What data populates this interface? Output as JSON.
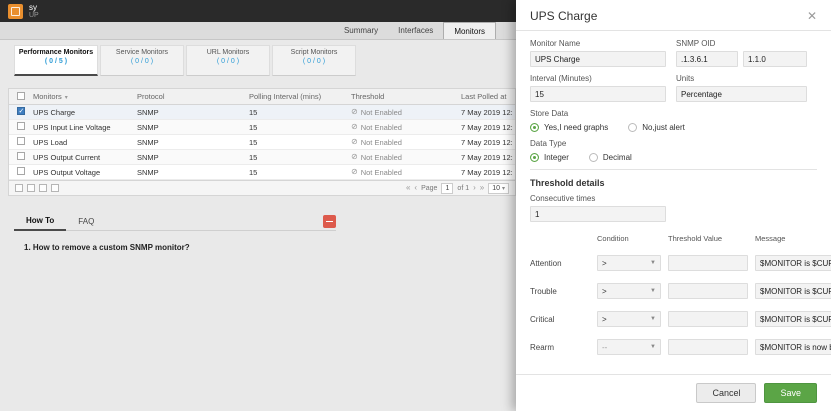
{
  "colors": {
    "brand_orange": "#e98f2e",
    "accent_green": "#5ba546",
    "count_blue": "#2e9cd6"
  },
  "topbar": {
    "title": "sy",
    "subtitle": "UP"
  },
  "nav": {
    "tabs": [
      {
        "label": "Summary"
      },
      {
        "label": "Interfaces"
      },
      {
        "label": "Monitors"
      }
    ]
  },
  "monitor_tabs": [
    {
      "label": "Performance Monitors",
      "count": "( 0 / 5 )"
    },
    {
      "label": "Service Monitors",
      "count": "( 0 / 0 )"
    },
    {
      "label": "URL Monitors",
      "count": "( 0 / 0 )"
    },
    {
      "label": "Script Monitors",
      "count": "( 0 / 0 )"
    }
  ],
  "table": {
    "columns": {
      "monitors": "Monitors",
      "protocol": "Protocol",
      "interval": "Polling Interval (mins)",
      "threshold": "Threshold",
      "last_polled": "Last Polled at"
    },
    "not_enabled_icon": "⊘",
    "rows": [
      {
        "name": "UPS Charge",
        "protocol": "SNMP",
        "interval": "15",
        "threshold": "Not Enabled",
        "last_polled": "7 May 2019 12:"
      },
      {
        "name": "UPS Input Line Voltage",
        "protocol": "SNMP",
        "interval": "15",
        "threshold": "Not Enabled",
        "last_polled": "7 May 2019 12:"
      },
      {
        "name": "UPS Load",
        "protocol": "SNMP",
        "interval": "15",
        "threshold": "Not Enabled",
        "last_polled": "7 May 2019 12:"
      },
      {
        "name": "UPS Output Current",
        "protocol": "SNMP",
        "interval": "15",
        "threshold": "Not Enabled",
        "last_polled": "7 May 2019 12:"
      },
      {
        "name": "UPS Output Voltage",
        "protocol": "SNMP",
        "interval": "15",
        "threshold": "Not Enabled",
        "last_polled": "7 May 2019 12:"
      }
    ]
  },
  "pagination": {
    "page_label": "Page",
    "page_value": "1",
    "of_label": "of 1",
    "page_size": "10",
    "first": "«",
    "prev": "‹",
    "next": "›",
    "last": "»"
  },
  "help": {
    "tabs": [
      {
        "label": "How To"
      },
      {
        "label": "FAQ"
      }
    ],
    "question": "1. How to remove a custom SNMP monitor?"
  },
  "panel": {
    "title": "UPS Charge",
    "close_glyph": "✕",
    "monitor_name": {
      "label": "Monitor Name",
      "value": "UPS Charge"
    },
    "snmp_oid": {
      "label": "SNMP OID",
      "value1": ".1.3.6.1",
      "value2": "1.1.0"
    },
    "interval": {
      "label": "Interval (Minutes)",
      "value": "15"
    },
    "units": {
      "label": "Units",
      "value": "Percentage"
    },
    "store_data": {
      "label": "Store Data",
      "yes": "Yes,I need graphs",
      "no": "No,just alert"
    },
    "data_type": {
      "label": "Data Type",
      "integer": "Integer",
      "decimal": "Decimal"
    },
    "threshold": {
      "heading": "Threshold details",
      "consecutive_label": "Consecutive times",
      "consecutive_value": "1",
      "col_condition": "Condition",
      "col_value": "Threshold Value",
      "col_message": "Message",
      "rows": [
        {
          "label": "Attention",
          "condition": ">",
          "message": "$MONITOR is $CURRE"
        },
        {
          "label": "Trouble",
          "condition": ">",
          "message": "$MONITOR is $CURRE"
        },
        {
          "label": "Critical",
          "condition": ">",
          "message": "$MONITOR is $CURRE"
        },
        {
          "label": "Rearm",
          "condition": "--",
          "message": "$MONITOR is now ba"
        }
      ]
    },
    "cancel_label": "Cancel",
    "save_label": "Save"
  }
}
